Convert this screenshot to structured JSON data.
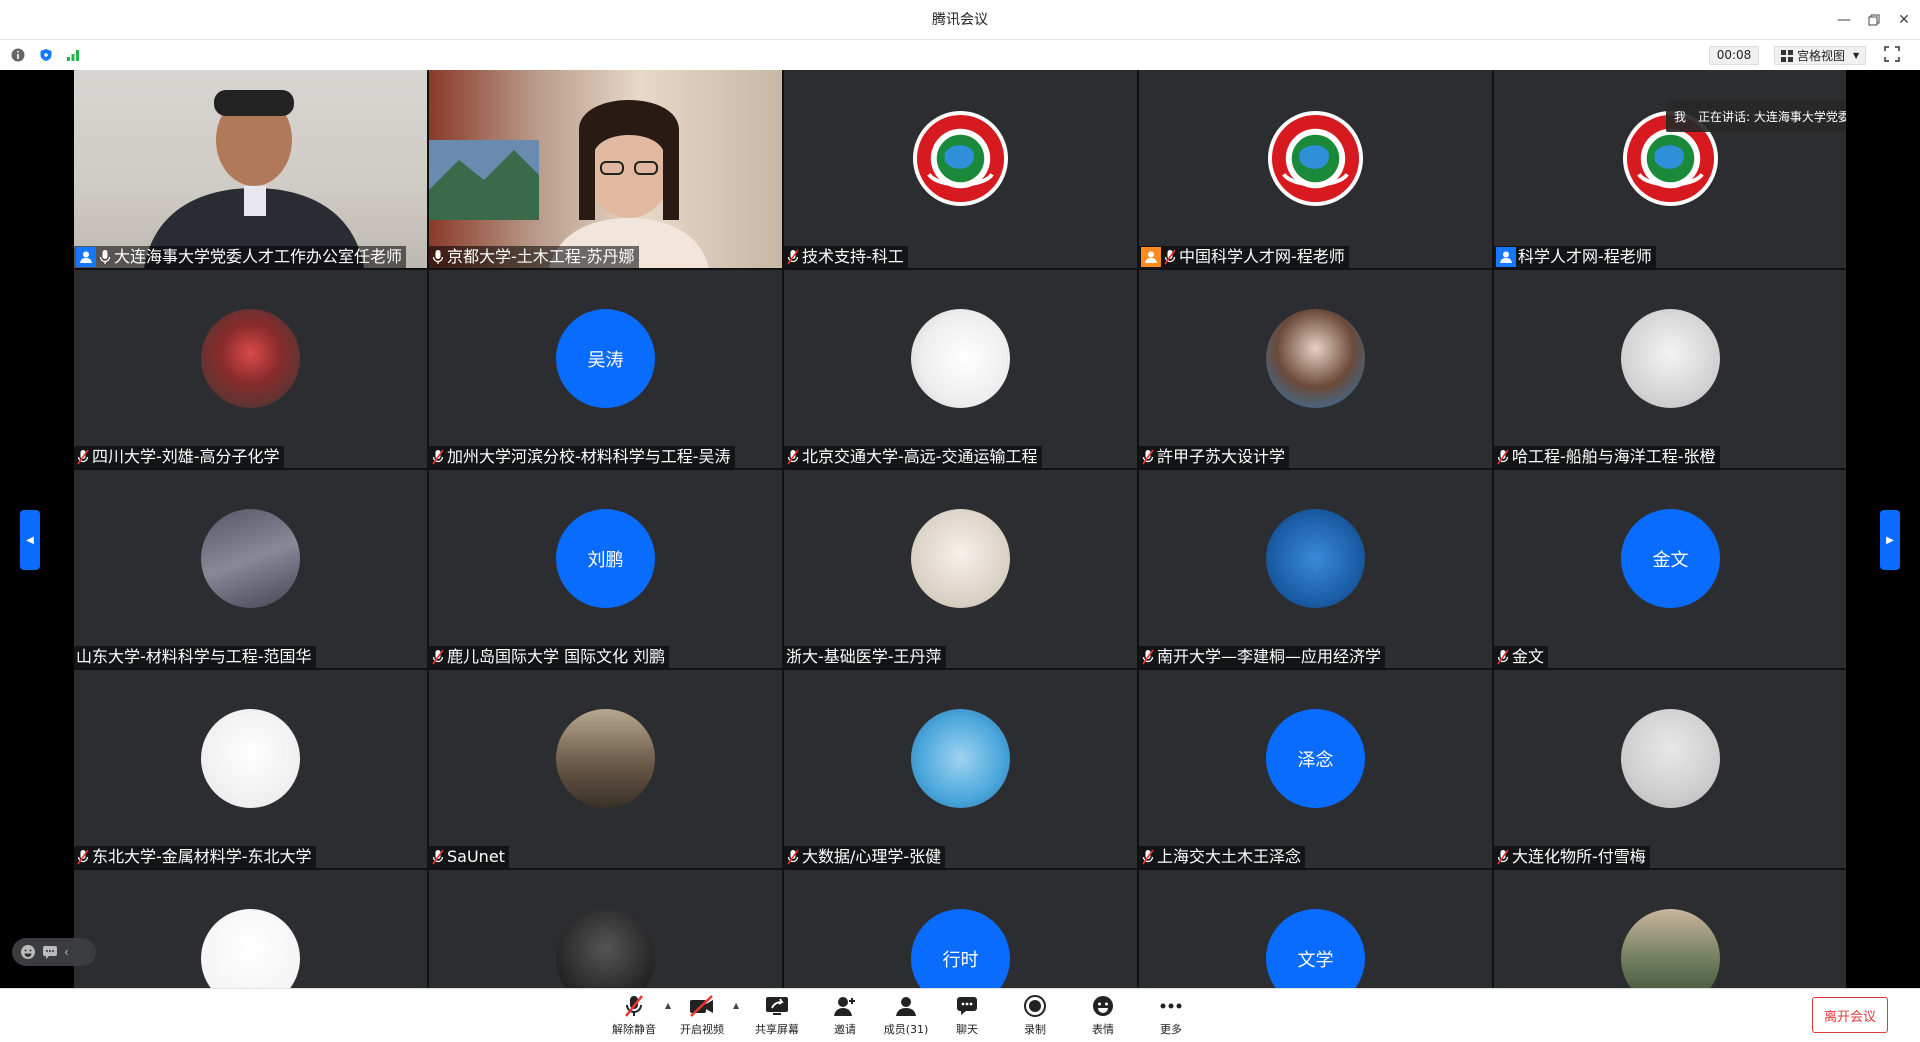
{
  "window": {
    "title": "腾讯会议"
  },
  "topbar": {
    "timer": "00:08",
    "view_label": "宫格视图"
  },
  "speaking": {
    "me": "我",
    "text": "正在讲话: 大连海事大学党委人..."
  },
  "tiles": [
    {
      "name": "大连海事大学党委人才工作办公室任老师",
      "type": "video",
      "badge": "blue",
      "mic": "on"
    },
    {
      "name": "京都大学-土木工程-苏丹娜",
      "type": "video",
      "badge": "none",
      "mic": "on"
    },
    {
      "name": "技术支持-科工",
      "type": "logo",
      "badge": "none",
      "mic": "muted"
    },
    {
      "name": "中国科学人才网-程老师",
      "type": "logo",
      "badge": "orange",
      "mic": "muted"
    },
    {
      "name": "科学人才网-程老师",
      "type": "logo",
      "badge": "blue",
      "mic": "none"
    },
    {
      "name": "四川大学-刘雄-高分子化学",
      "type": "photo",
      "badge": "none",
      "mic": "muted"
    },
    {
      "name": "加州大学河滨分校-材料科学与工程-吴涛",
      "type": "initials",
      "initials": "吴涛",
      "badge": "none",
      "mic": "muted"
    },
    {
      "name": "北京交通大学-高远-交通运输工程",
      "type": "photo",
      "badge": "none",
      "mic": "muted"
    },
    {
      "name": "許甲子苏大设计学",
      "type": "photo",
      "badge": "none",
      "mic": "muted"
    },
    {
      "name": "哈工程-船舶与海洋工程-张橙",
      "type": "photo",
      "badge": "none",
      "mic": "muted"
    },
    {
      "name": "山东大学-材料科学与工程-范国华",
      "type": "photo",
      "badge": "none",
      "mic": "none"
    },
    {
      "name": "鹿儿岛国际大学 国际文化 刘鹏",
      "type": "initials",
      "initials": "刘鹏",
      "badge": "none",
      "mic": "muted"
    },
    {
      "name": "浙大-基础医学-王丹萍",
      "type": "photo",
      "badge": "none",
      "mic": "none"
    },
    {
      "name": "南开大学—李建桐—应用经济学",
      "type": "photo",
      "badge": "none",
      "mic": "muted"
    },
    {
      "name": "金文",
      "type": "initials",
      "initials": "金文",
      "badge": "none",
      "mic": "muted"
    },
    {
      "name": "东北大学-金属材料学-东北大学",
      "type": "photo",
      "badge": "none",
      "mic": "muted"
    },
    {
      "name": "SaUnet",
      "type": "photo",
      "badge": "none",
      "mic": "muted"
    },
    {
      "name": "大数据/心理学-张健",
      "type": "photo",
      "badge": "none",
      "mic": "muted"
    },
    {
      "name": "上海交大土木王泽念",
      "type": "initials",
      "initials": "泽念",
      "badge": "none",
      "mic": "muted"
    },
    {
      "name": "大连化物所-付雪梅",
      "type": "photo",
      "badge": "none",
      "mic": "muted"
    },
    {
      "name": "",
      "type": "photo",
      "badge": "none",
      "mic": "none"
    },
    {
      "name": "",
      "type": "photo",
      "badge": "none",
      "mic": "none"
    },
    {
      "name": "",
      "type": "initials",
      "initials": "行时",
      "badge": "none",
      "mic": "none"
    },
    {
      "name": "",
      "type": "initials",
      "initials": "文学",
      "badge": "none",
      "mic": "none"
    },
    {
      "name": "",
      "type": "photo",
      "badge": "none",
      "mic": "none"
    }
  ],
  "bottombar": {
    "unmute": "解除静音",
    "start_video": "开启视频",
    "share_screen": "共享屏幕",
    "invite": "邀请",
    "members": "成员(31)",
    "chat": "聊天",
    "record": "录制",
    "emoji": "表情",
    "more": "更多",
    "leave": "离开会议"
  },
  "colors": {
    "accent": "#0a6cff",
    "leave": "#e03a3a",
    "tile_bg": "#2b2d30"
  }
}
